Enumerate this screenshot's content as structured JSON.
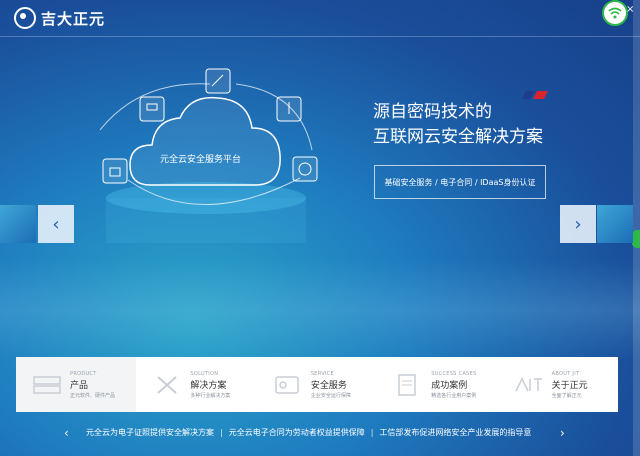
{
  "header": {
    "logo_text": "吉大正元",
    "wifi_icon": "wifi-icon",
    "close_label": "×"
  },
  "hero": {
    "cloud_label": "元全云安全服务平台",
    "headline_line1": "源自密码技术的",
    "headline_line2": "互联网云安全解决方案",
    "tagline": "基础安全服务 / 电子合同 / IDaaS身份认证",
    "prev_label": "‹",
    "next_label": "›"
  },
  "cards": [
    {
      "en": "PRODUCT",
      "cn": "产品",
      "sub": "正元软件、硬件产品"
    },
    {
      "en": "SOLUTION",
      "cn": "解决方案",
      "sub": "多种行业解决方案"
    },
    {
      "en": "SERVICE",
      "cn": "安全服务",
      "sub": "企业安全运行保障"
    },
    {
      "en": "SUCCESS CASES",
      "cn": "成功案例",
      "sub": "精选各行业用户案例"
    },
    {
      "en": "ABOUT JIT",
      "cn": "关于正元",
      "sub": "全面了解正元"
    }
  ],
  "news": {
    "prev_label": "‹",
    "next_label": "›",
    "items": [
      "元全云为电子证照提供安全解决方案",
      "元全云电子合同为劳动者权益提供保障",
      "工信部发布促进网络安全产业发展的指导意"
    ]
  },
  "colors": {
    "accent": "#2061b3",
    "flag_red": "#d9232d",
    "flag_blue": "#1e3c8a",
    "wifi_green": "#2eb84a"
  }
}
